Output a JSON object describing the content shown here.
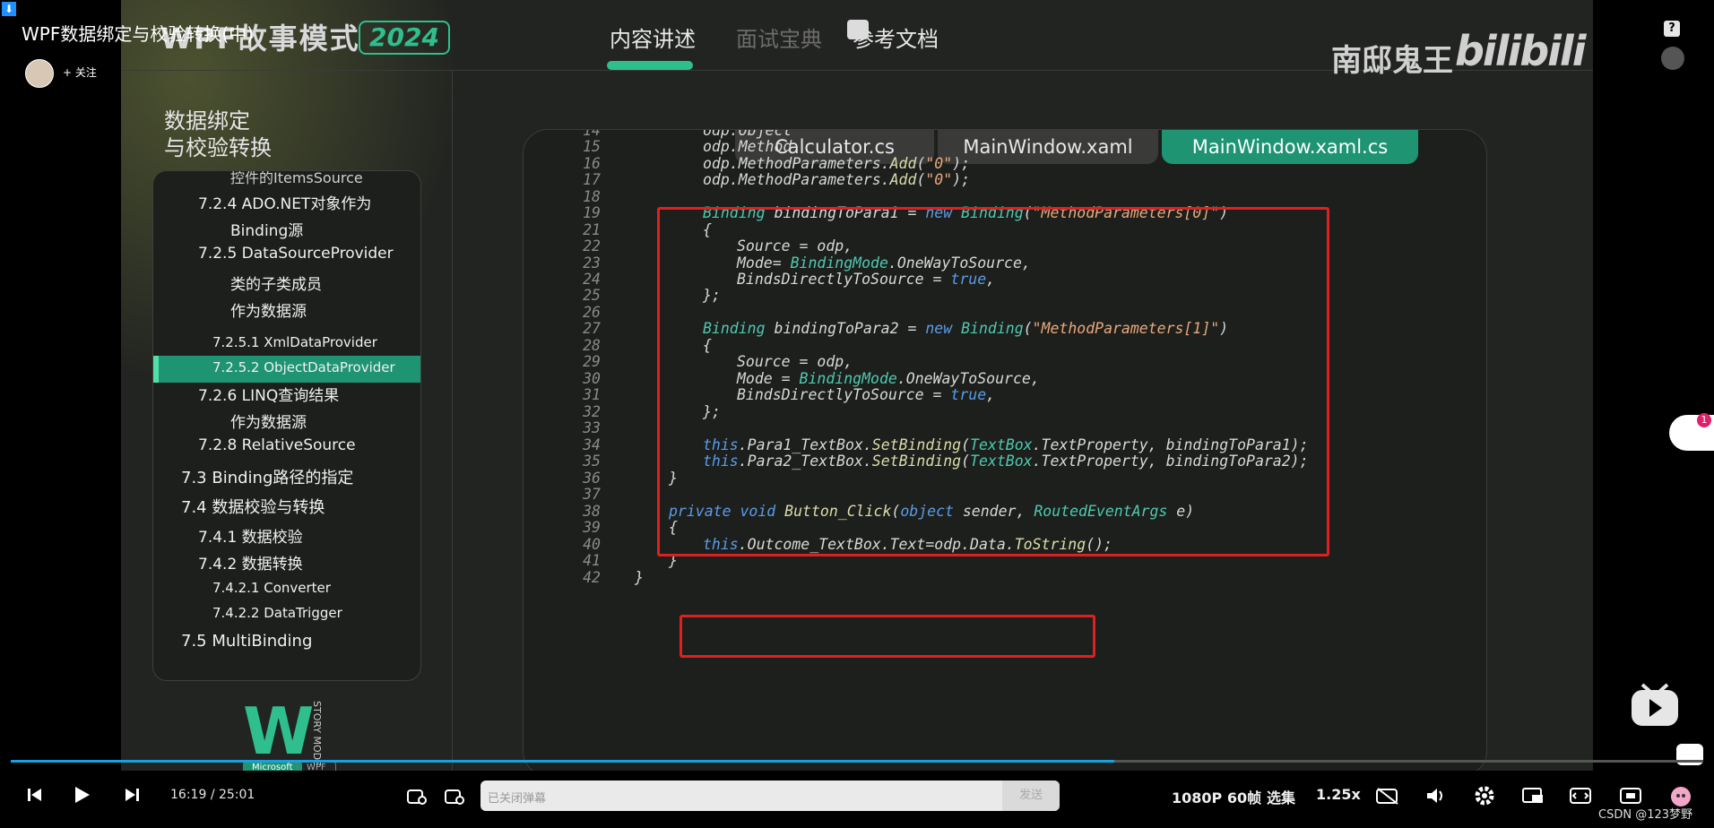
{
  "video_title": "WPF数据绑定与校验转换(中)",
  "uploader": {
    "follow_label": "+ 关注"
  },
  "slide": {
    "series_title": "WPF故事模式",
    "year": "2024",
    "nav": [
      {
        "label": "内容讲述",
        "active": true
      },
      {
        "label": "面试宝典",
        "active": false
      },
      {
        "label": "参考文档",
        "active": false
      }
    ],
    "brand": "南邸鬼王",
    "platform_logo": "bilibili",
    "sidebar_title_line1": "数据绑定",
    "sidebar_title_line2": "与校验转换",
    "toc": [
      "控件的ItemsSource",
      "7.2.4 ADO.NET对象作为",
      "Binding源",
      "7.2.5 DataSourceProvider",
      "类的子类成员",
      "作为数据源",
      "7.2.5.1 XmlDataProvider",
      "7.2.5.2 ObjectDataProvider",
      "7.2.6 LINQ查询结果",
      "作为数据源",
      "7.2.8 RelativeSource",
      "7.3 Binding路径的指定",
      "7.4 数据校验与转换",
      "7.4.1 数据校验",
      "7.4.2 数据转换",
      "7.4.2.1 Converter",
      "7.4.2.2 DataTrigger",
      "7.5 MultiBinding"
    ],
    "toc_active": "7.2.5.2 ObjectDataProvider",
    "logo_letter_w": "W",
    "logo_vertical": "STORY MODE",
    "logo_tag_ms": "Microsoft",
    "logo_tag_wpf": "WPF",
    "tabs": [
      "Calculator.cs",
      "MainWindow.xaml",
      "MainWindow.xaml.cs"
    ],
    "active_tab": "MainWindow.xaml.cs",
    "code_lines": [
      {
        "n": "14",
        "text": "odp.Object"
      },
      {
        "n": "15",
        "text": "odp.Method"
      },
      {
        "n": "16",
        "text": "odp.MethodParameters.Add(\"0\");"
      },
      {
        "n": "17",
        "text": "odp.MethodParameters.Add(\"0\");"
      },
      {
        "n": "18",
        "text": ""
      },
      {
        "n": "19",
        "text": "Binding bindingToPara1 = new Binding(\"MethodParameters[0]\")"
      },
      {
        "n": "21",
        "text": "{"
      },
      {
        "n": "22",
        "text": "Source = odp,"
      },
      {
        "n": "23",
        "text": "Mode= BindingMode.OneWayToSource,"
      },
      {
        "n": "24",
        "text": "BindsDirectlyToSource = true,"
      },
      {
        "n": "25",
        "text": "};"
      },
      {
        "n": "26",
        "text": ""
      },
      {
        "n": "27",
        "text": "Binding bindingToPara2 = new Binding(\"MethodParameters[1]\")"
      },
      {
        "n": "28",
        "text": "{"
      },
      {
        "n": "29",
        "text": "Source = odp,"
      },
      {
        "n": "30",
        "text": "Mode = BindingMode.OneWayToSource,"
      },
      {
        "n": "31",
        "text": "BindsDirectlyToSource = true,"
      },
      {
        "n": "32",
        "text": "};"
      },
      {
        "n": "33",
        "text": ""
      },
      {
        "n": "34",
        "text": "this.Para1_TextBox.SetBinding(TextBox.TextProperty, bindingToPara1);"
      },
      {
        "n": "35",
        "text": "this.Para2_TextBox.SetBinding(TextBox.TextProperty, bindingToPara2);"
      },
      {
        "n": "36",
        "text": "}"
      },
      {
        "n": "37",
        "text": ""
      },
      {
        "n": "38",
        "text": "private void Button_Click(object sender, RoutedEventArgs e)"
      },
      {
        "n": "39",
        "text": "{"
      },
      {
        "n": "40",
        "text": "this.Outcome_TextBox.Text=odp.Data.ToString();"
      },
      {
        "n": "41",
        "text": "}"
      },
      {
        "n": "42",
        "text": "}"
      }
    ]
  },
  "player": {
    "time_current": "16:19",
    "time_total": "25:01",
    "time_sep": "/",
    "progress": 0.652,
    "danmaku_placeholder": "已关闭弹幕",
    "send_label": "发送",
    "quality": "1080P 60帧",
    "episodes": "选集",
    "speed": "1.25x",
    "icons": [
      "prev-icon",
      "play-icon",
      "next-icon",
      "danmaku-toggle-icon",
      "danmaku-settings-icon",
      "danmaku-off-icon",
      "volume-icon",
      "settings-icon",
      "pip-icon",
      "widescreen-icon",
      "web-fullscreen-icon"
    ]
  },
  "side": {
    "help_label": "?",
    "badge_count": "1"
  },
  "watermark": "CSDN @123梦野"
}
